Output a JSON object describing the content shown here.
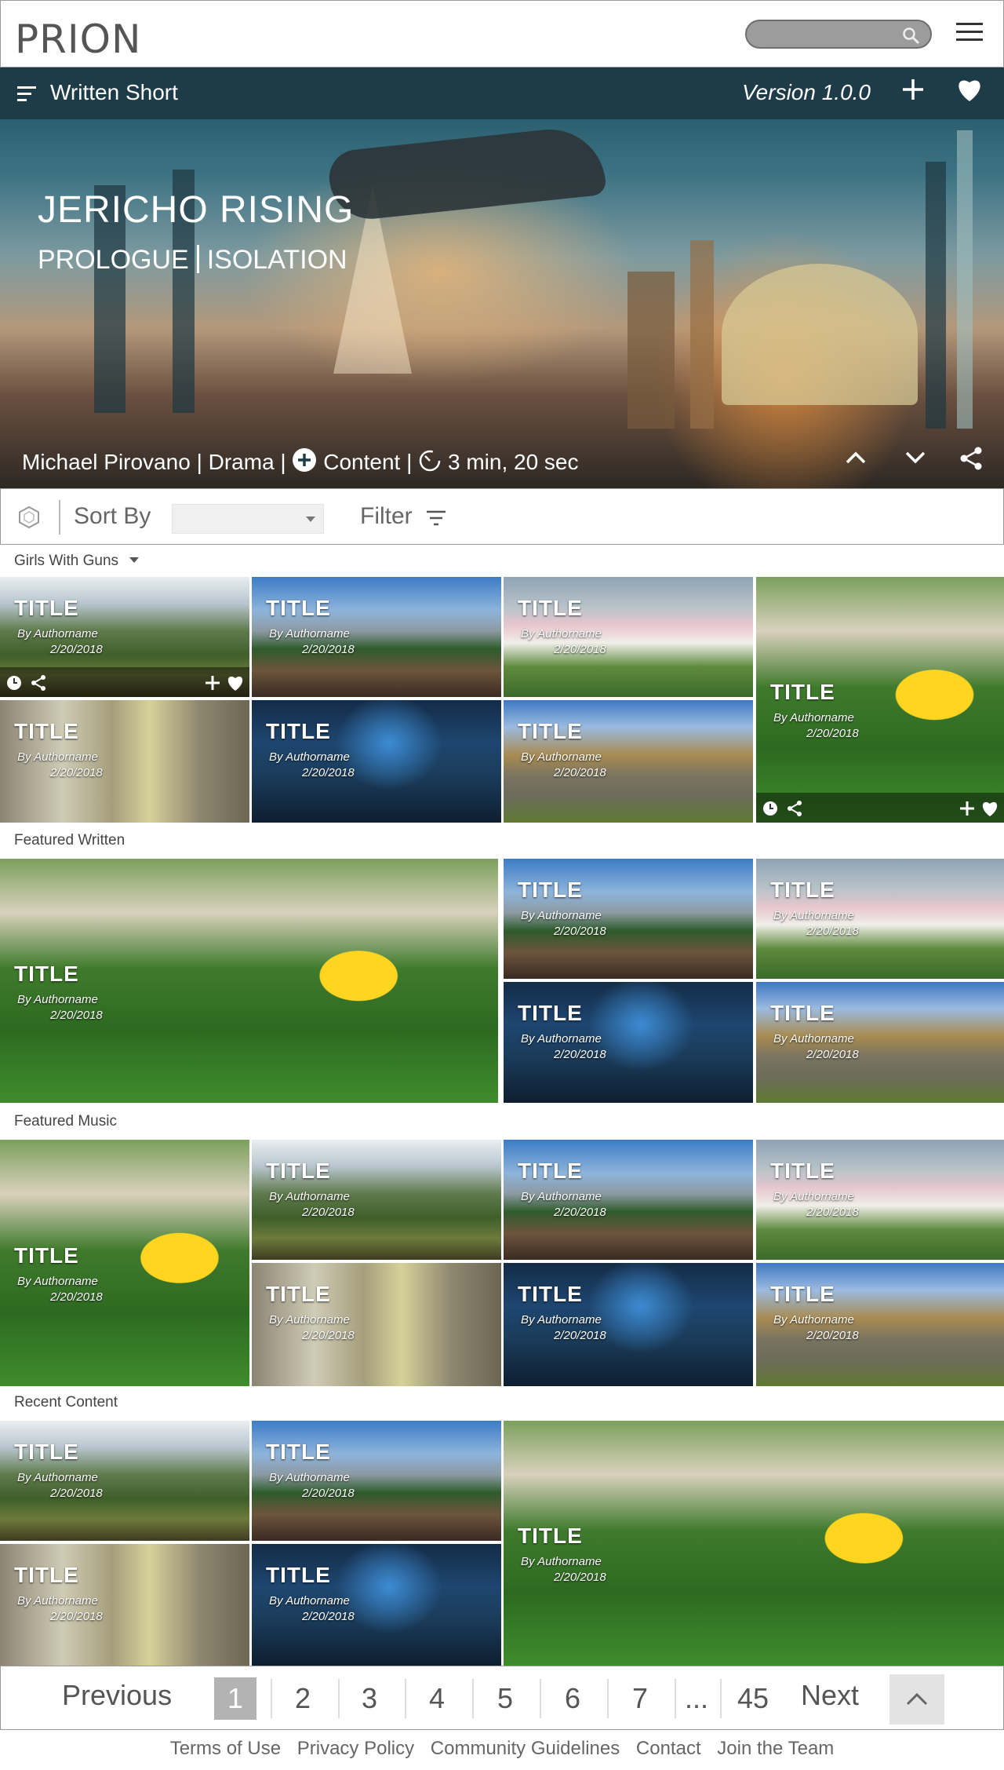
{
  "header": {
    "logo": "PRION",
    "search": {
      "placeholder": ""
    }
  },
  "hero_bar": {
    "section_title": "Written Short",
    "version": "Version 1.0.0"
  },
  "hero": {
    "title": "JERICHO RISING",
    "subtitle_left": "PROLOGUE",
    "subtitle_right": "ISOLATION",
    "author": "Michael Pirovano",
    "genre": "Drama",
    "content_label": "Content",
    "duration": "3 min, 20 sec"
  },
  "toolbar": {
    "sort_label": "Sort By",
    "sort_value": "",
    "filter_label": "Filter"
  },
  "sections": [
    {
      "label": "Girls With Guns"
    },
    {
      "label": "Featured Written"
    },
    {
      "label": "Featured Music"
    },
    {
      "label": "Recent Content"
    }
  ],
  "tile": {
    "title": "TITLE",
    "author": "By Authorname",
    "date": "2/20/2018"
  },
  "pagination": {
    "previous": "Previous",
    "pages": [
      "1",
      "2",
      "3",
      "4",
      "5",
      "6",
      "7",
      "...",
      "45"
    ],
    "current": "1",
    "next": "Next"
  },
  "footer": {
    "links": [
      "Terms of Use",
      "Privacy Policy",
      "Community Guidelines",
      "Contact",
      "Join the Team"
    ]
  }
}
